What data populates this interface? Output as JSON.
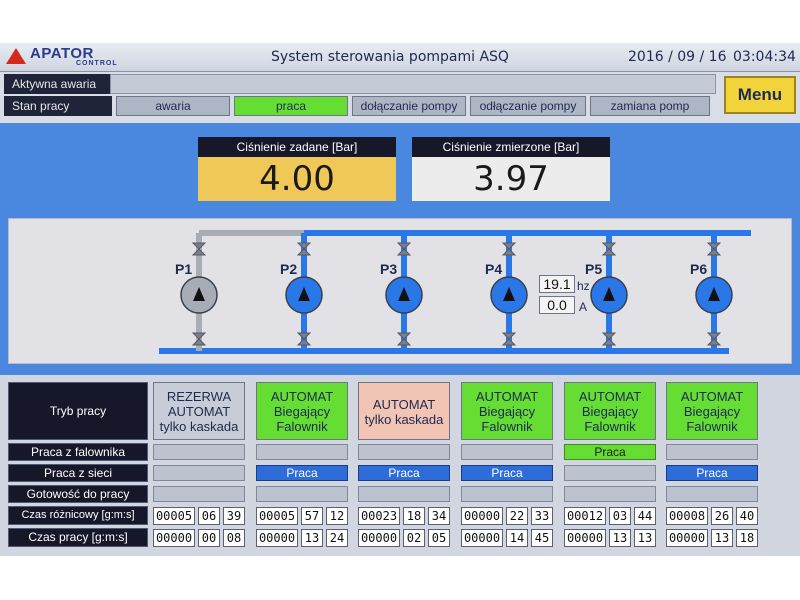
{
  "header": {
    "logo_main": "APATOR",
    "logo_sub": "CONTROL",
    "title": "System sterowania pompami ASQ",
    "date": "2016 / 09 / 16",
    "time": "03:04:34"
  },
  "status": {
    "alarm_label": "Aktywna awaria",
    "alarm_value": "",
    "mode_label": "Stan pracy",
    "states": [
      "awaria",
      "praca",
      "dołączanie pompy",
      "odłączanie pompy",
      "zamiana pomp"
    ],
    "active_state": "praca",
    "menu_label": "Menu"
  },
  "pressure": {
    "set_label": "Ciśnienie zadane [Bar]",
    "set_value": "4.00",
    "measured_label": "Ciśnienie zmierzone [Bar]",
    "measured_value": "3.97"
  },
  "diagram": {
    "pumps": [
      "P1",
      "P2",
      "P3",
      "P4",
      "P5",
      "P6"
    ],
    "pump_status_colors": {
      "P1": "#a8acb4",
      "P2": "#2a78e8",
      "P3": "#2a78e8",
      "P4": "#2a78e8",
      "P5": "#2a78e8",
      "P6": "#2a78e8"
    },
    "inverter_freq": "19.1",
    "inverter_freq_unit": "hz",
    "inverter_current": "0.0",
    "inverter_current_unit": "A"
  },
  "table": {
    "row_labels": {
      "mode": "Tryb pracy",
      "from_inverter": "Praca z falownika",
      "from_grid": "Praca z sieci",
      "ready": "Gotowość do pracy",
      "diff_time": "Czas różnicowy [g:m:s]",
      "work_time": "Czas pracy [g:m:s]"
    },
    "pumps": [
      {
        "mode": [
          "REZERWA",
          "AUTOMAT",
          "tylko kaskada"
        ],
        "mode_color": "#c8ccd6",
        "inverter": "",
        "grid": "",
        "ready": "",
        "diff": [
          "00005",
          "06",
          "39"
        ],
        "work": [
          "00000",
          "00",
          "08"
        ]
      },
      {
        "mode": [
          "AUTOMAT",
          "Biegający",
          "Falownik"
        ],
        "mode_color": "#66dd33",
        "inverter": "",
        "grid": "Praca",
        "ready": "",
        "diff": [
          "00005",
          "57",
          "12"
        ],
        "work": [
          "00000",
          "13",
          "24"
        ]
      },
      {
        "mode": [
          "AUTOMAT",
          "tylko kaskada"
        ],
        "mode_color": "#f2c4b4",
        "inverter": "",
        "grid": "Praca",
        "ready": "",
        "diff": [
          "00023",
          "18",
          "34"
        ],
        "work": [
          "00000",
          "02",
          "05"
        ]
      },
      {
        "mode": [
          "AUTOMAT",
          "Biegający",
          "Falownik"
        ],
        "mode_color": "#66dd33",
        "inverter": "",
        "grid": "Praca",
        "ready": "",
        "diff": [
          "00000",
          "22",
          "33"
        ],
        "work": [
          "00000",
          "14",
          "45"
        ]
      },
      {
        "mode": [
          "AUTOMAT",
          "Biegający",
          "Falownik"
        ],
        "mode_color": "#66dd33",
        "inverter": "Praca",
        "grid": "",
        "ready": "",
        "diff": [
          "00012",
          "03",
          "44"
        ],
        "work": [
          "00000",
          "13",
          "13"
        ]
      },
      {
        "mode": [
          "AUTOMAT",
          "Biegający",
          "Falownik"
        ],
        "mode_color": "#66dd33",
        "inverter": "",
        "grid": "Praca",
        "ready": "",
        "diff": [
          "00008",
          "26",
          "40"
        ],
        "work": [
          "00000",
          "13",
          "18"
        ]
      }
    ]
  }
}
